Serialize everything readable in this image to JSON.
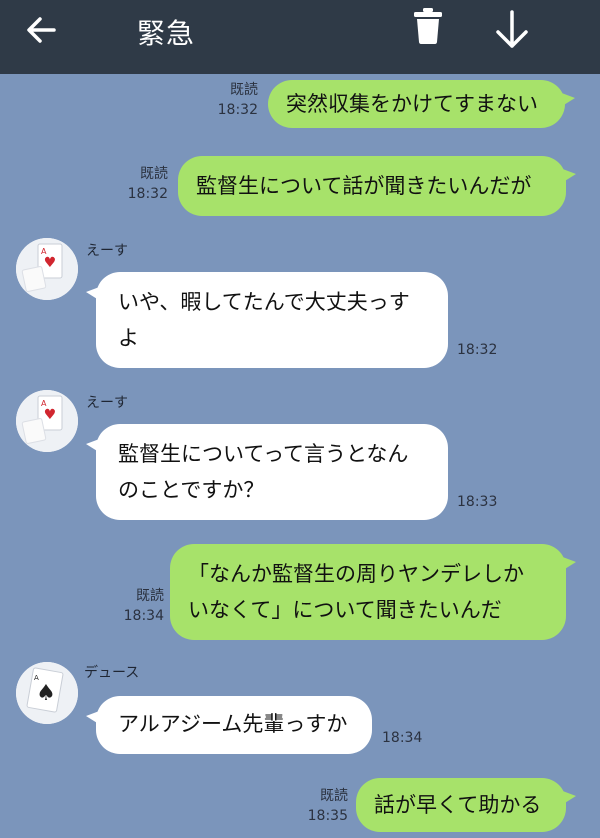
{
  "header": {
    "title": "緊急",
    "back_icon": "arrow-left-icon",
    "trash_icon": "trash-icon",
    "down_icon": "arrow-down-icon",
    "background": "#2f3a47"
  },
  "colors": {
    "chat_background": "#7b95bb",
    "outgoing_bubble": "#a7e26a",
    "incoming_bubble": "#ffffff"
  },
  "messages": [
    {
      "direction": "out",
      "text": "突然収集をかけてすまない",
      "read": "既読",
      "time": "18:32"
    },
    {
      "direction": "out",
      "text": "監督生について話が聞きたいんだが",
      "read": "既読",
      "time": "18:32"
    },
    {
      "direction": "in",
      "sender": "えーす",
      "lines": [
        "いや、暇してたんで大丈夫っす",
        "よ"
      ],
      "time": "18:32"
    },
    {
      "direction": "in",
      "sender": "えーす",
      "lines": [
        "監督生についてって言うとなん",
        "のことですか？"
      ],
      "time": "18:33"
    },
    {
      "direction": "out",
      "lines": [
        "「なんか監督生の周りヤンデレしか",
        "いなくて」について聞きたいんだ"
      ],
      "read": "既読",
      "time": "18:34"
    },
    {
      "direction": "in",
      "sender": "デュース",
      "text": "アルアジーム先輩っすか",
      "time": "18:34"
    },
    {
      "direction": "out",
      "text": "話が早くて助かる",
      "read": "既読",
      "time": "18:35"
    }
  ]
}
